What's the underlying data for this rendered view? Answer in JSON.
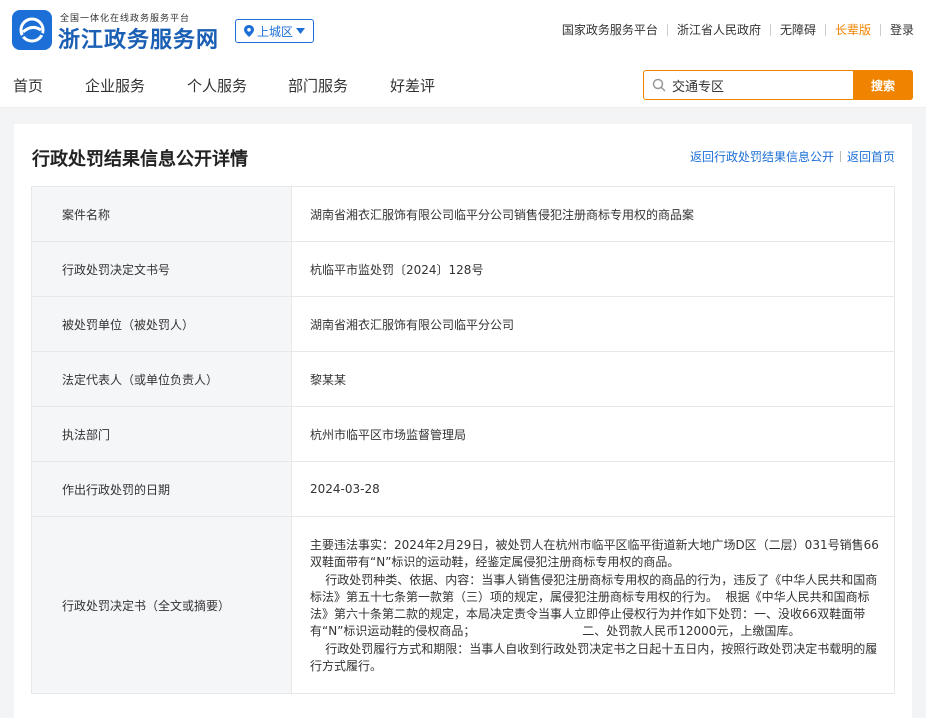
{
  "header": {
    "logo_subtitle": "全国一体化在线政务服务平台",
    "logo_title": "浙江政务服务网",
    "region": "上城区",
    "links": [
      "国家政务服务平台",
      "浙江省人民政府",
      "无障碍",
      "长辈版",
      "登录"
    ]
  },
  "nav": {
    "items": [
      "首页",
      "企业服务",
      "个人服务",
      "部门服务",
      "好差评"
    ]
  },
  "search": {
    "value": "交通专区",
    "button": "搜索"
  },
  "page": {
    "title": "行政处罚结果信息公开详情",
    "back_link_list": "返回行政处罚结果信息公开",
    "back_link_home": "返回首页"
  },
  "detail": {
    "rows": [
      {
        "label": "案件名称",
        "value": "湖南省湘衣汇服饰有限公司临平分公司销售侵犯注册商标专用权的商品案"
      },
      {
        "label": "行政处罚决定文书号",
        "value": "杭临平市监处罚〔2024〕128号"
      },
      {
        "label": "被处罚单位（被处罚人）",
        "value": "湖南省湘衣汇服饰有限公司临平分公司"
      },
      {
        "label": "法定代表人（或单位负责人）",
        "value": "黎某某"
      },
      {
        "label": "执法部门",
        "value": "杭州市临平区市场监督管理局"
      },
      {
        "label": "作出行政处罚的日期",
        "value": "2024-03-28"
      }
    ],
    "decision_label": "行政处罚决定书（全文或摘要）",
    "decision_text": "主要违法事实：2024年2月29日，被处罚人在杭州市临平区临平街道新大地广场D区（二层）031号销售66双鞋面带有“N”标识的运动鞋，经鉴定属侵犯注册商标专用权的商品。\n    行政处罚种类、依据、内容：当事人销售侵犯注册商标专用权的商品的行为，违反了《中华人民共和国商标法》第五十七条第一款第（三）项的规定，属侵犯注册商标专用权的行为。  根据《中华人民共和国商标法》第六十条第二款的规定，本局决定责令当事人立即停止侵权行为并作如下处罚：一、没收66双鞋面带有“N”标识运动鞋的侵权商品；                            二、处罚款人民币12000元，上缴国库。\n    行政处罚履行方式和期限：当事人自收到行政处罚决定书之日起十五日内，按照行政处罚决定书载明的履行方式履行。"
  },
  "colors": {
    "brand_blue": "#1c6fd6",
    "accent_orange": "#f08300",
    "label_bg": "#f5f6f8"
  },
  "icons": [
    "app-logo-icon",
    "location-pin-icon",
    "caret-down-icon",
    "search-icon"
  ]
}
